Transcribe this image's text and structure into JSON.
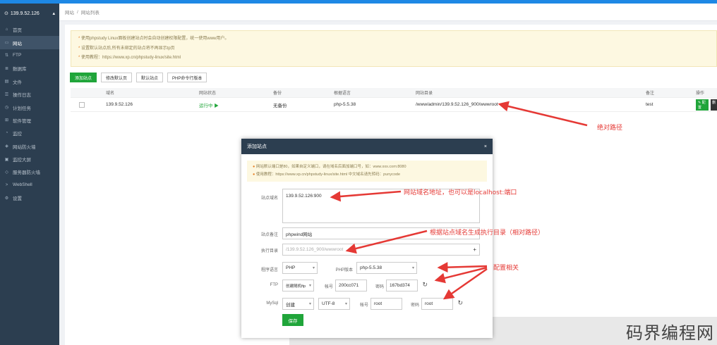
{
  "header": {
    "server": "139.9.52.126"
  },
  "sidebar": {
    "items": [
      {
        "label": "首页",
        "icon": "home-icon",
        "glyph": "⌂"
      },
      {
        "label": "网站",
        "icon": "monitor-icon",
        "glyph": "▭"
      },
      {
        "label": "FTP",
        "icon": "ftp-icon",
        "glyph": "⇅"
      },
      {
        "label": "数据库",
        "icon": "database-icon",
        "glyph": "≣"
      },
      {
        "label": "文件",
        "icon": "folder-icon",
        "glyph": "▤"
      },
      {
        "label": "操作日志",
        "icon": "log-icon",
        "glyph": "☰"
      },
      {
        "label": "计划任务",
        "icon": "clock-icon",
        "glyph": "◷"
      },
      {
        "label": "软件管理",
        "icon": "apps-icon",
        "glyph": "⊞"
      },
      {
        "label": "监控",
        "icon": "monitor-chart-icon",
        "glyph": "◔"
      },
      {
        "label": "网站防火墙",
        "icon": "shield-icon",
        "glyph": "◈"
      },
      {
        "label": "监控大屏",
        "icon": "screen-icon",
        "glyph": "▣"
      },
      {
        "label": "服务器防火墙",
        "icon": "firewall-icon",
        "glyph": "◇"
      },
      {
        "label": "WebShell",
        "icon": "terminal-icon",
        "glyph": ">"
      },
      {
        "label": "设置",
        "icon": "gear-icon",
        "glyph": "⚙"
      }
    ]
  },
  "breadcrumb": {
    "root": "网站",
    "sep": "/",
    "current": "网站列表"
  },
  "notice": {
    "lines": [
      "使用phpstudy Linux面板创建站点时会自动创建权限配置，统一使用www用户。",
      "设置默认站点后,所有未绑定的站点将不再显示tp页",
      "使用教程：https://www.xp.cn/phpstudy-linux/site.html"
    ]
  },
  "toolbar": {
    "add_site": "添加站点",
    "default_page": "修改默认页",
    "default_site": "默认站点",
    "php_cli": "PHP命令行版本"
  },
  "table": {
    "headers": [
      "",
      "域名",
      "网站状态",
      "备份",
      "根据语言",
      "网站目录",
      "备注",
      "操作"
    ],
    "rows": [
      {
        "domain": "139.9.52.126",
        "status": "运行中",
        "status_icon": "▶",
        "backup": "无备份",
        "lang": "php-5.5.38",
        "dir": "/www/admin/139.9.52.126_900/wwwroot",
        "note": "test",
        "config": "✎ 配置",
        "delete": "删"
      }
    ]
  },
  "modal": {
    "title": "添加站点",
    "close": "×",
    "notice": [
      "网站默认端口是80，如果自定义端口，请在域名后面加端口号，如：www.xxx.com:8080",
      "使用教程：https://www.xp.cn/phpstudy-linux/site.html    中文域名请先转码：punycode"
    ],
    "fields": {
      "domain_label": "站点域名",
      "domain_value": "139.9.52.126:900",
      "remark_label": "站点备注",
      "remark_value": "phpwind网站",
      "dir_label": "执行目录",
      "dir_value": "/139.9.52.126_900/wwwroot",
      "dir_add": "+",
      "lang_label": "程序语言",
      "lang_value": "PHP",
      "phpver_label": "PHP版本",
      "phpver_value": "php-5.5.38",
      "ftp_label": "FTP",
      "ftp_mode": "创建随机ftp",
      "ftp_user_label": "帐号",
      "ftp_user": "200cc071",
      "ftp_pass_label": "密码",
      "ftp_pass": "167bd374",
      "mysql_label": "MySql",
      "mysql_mode": "创建",
      "mysql_charset": "UTF-8",
      "mysql_user_label": "帐号",
      "mysql_user": "root",
      "mysql_pass_label": "密码",
      "mysql_pass": "root",
      "refresh": "↻"
    },
    "submit": "保存"
  },
  "annotations": {
    "absolute_path": "绝对路径",
    "domain_hint": "网站域名地址，也可以是localhost:端口",
    "dir_hint": "根据站点域名生成执行目录（相对路径）",
    "config_hint": "配置相关"
  },
  "watermark": "码界编程网",
  "colors": {
    "sidebar": "#2c3e50",
    "accent": "#20a53a",
    "annotation": "#e53935"
  }
}
